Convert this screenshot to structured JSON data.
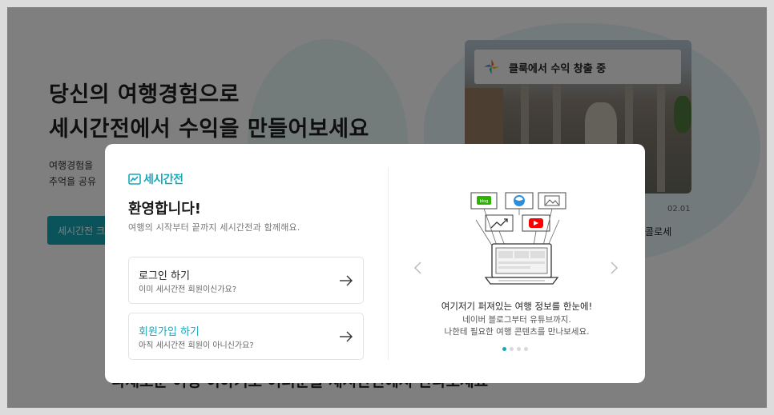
{
  "hero": {
    "title_line1": "당신의 여행경험으로",
    "title_line2": "세시간전에서 수익을 만들어보세요",
    "desc_line1": "여행경험을",
    "desc_line2": "추억을 공유",
    "cta_label": "세시간전 크"
  },
  "feature_card": {
    "chip_text": "클룩에서 수익 창출 중",
    "date": "02.01",
    "caption": "콜로세"
  },
  "bottom_text": "다채로운 여행 이야기로 여러분을 세시간전에서 만나보세요",
  "modal": {
    "logo_text": "세시간전",
    "welcome": "환영합니다!",
    "subtitle": "여행의 시작부터 끝까지 세시간전과 함께해요.",
    "login": {
      "title": "로그인 하기",
      "sub": "이미 세시간전 회원이신가요?"
    },
    "signup": {
      "title": "회원가입 하기",
      "sub": "아직 세시간전 회원이 아니신가요?"
    },
    "slide": {
      "badge_blog": "blog",
      "title": "여기저기 퍼져있는 여행 정보를 한눈에!",
      "desc_line1": "네이버 블로그부터 유튜브까지.",
      "desc_line2": "나한테 필요한 여행 콘텐츠를 만나보세요."
    },
    "carousel": {
      "total": 4,
      "active": 1
    }
  },
  "colors": {
    "accent": "#16a9bd",
    "cta": "#15a6b4",
    "overlay": "rgba(0,0,0,0.5)"
  }
}
